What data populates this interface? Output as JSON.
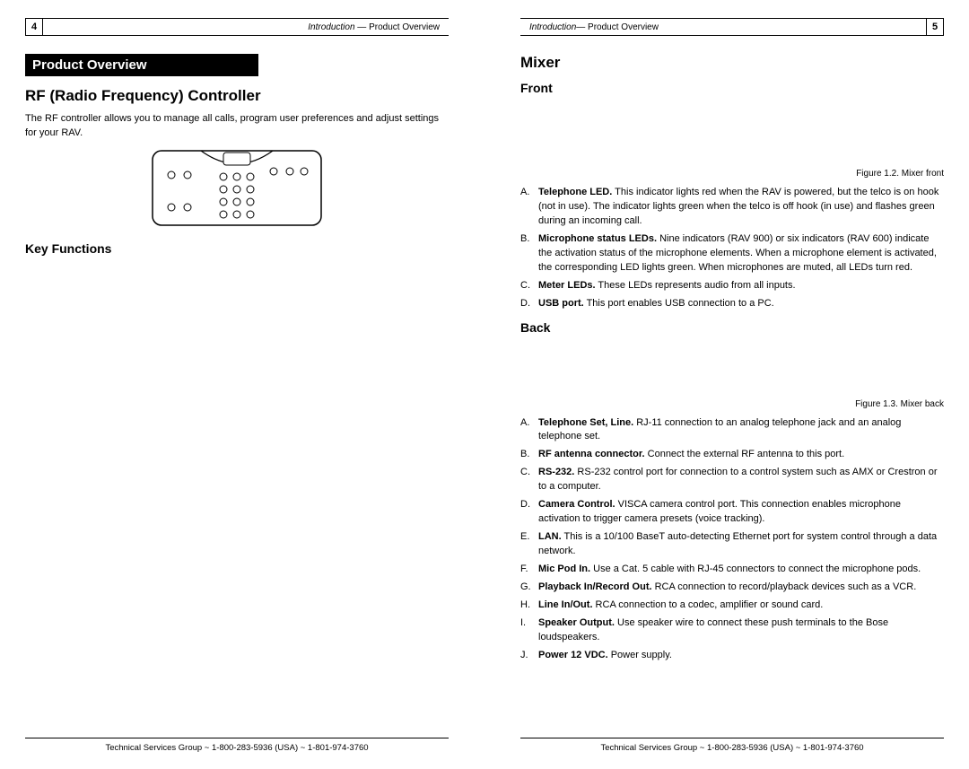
{
  "left": {
    "pageNum": "4",
    "header": {
      "italic": "Introduction",
      "rest": " — Product Overview"
    },
    "sectionBar": "Product Overview",
    "h1": "RF (Radio Frequency) Controller",
    "intro": "The RF controller allows you to manage all calls, program user preferences and adjust settings for your RAV.",
    "keyFunctions": "Key Functions",
    "footer": "Technical Services Group ~ 1-800-283-5936 (USA) ~ 1-801-974-3760"
  },
  "right": {
    "pageNum": "5",
    "header": {
      "italic": "Introduction",
      "rest": "— Product Overview"
    },
    "mixer": "Mixer",
    "front": "Front",
    "frontCaption": "Figure 1.2. Mixer front",
    "frontItems": [
      {
        "letter": "A.",
        "term": "Telephone LED.",
        "desc": " This indicator lights red when the RAV is powered, but the telco is on hook (not in use). The indicator lights green when the telco is off hook (in use) and flashes green during an incoming call."
      },
      {
        "letter": "B.",
        "term": "Microphone status LEDs.",
        "desc": " Nine indicators (RAV 900) or six indicators (RAV 600) indicate the activation status of the microphone elements. When a microphone element is activated, the corresponding LED lights green. When microphones are muted, all LEDs turn red."
      },
      {
        "letter": "C.",
        "term": "Meter LEDs.",
        "desc": " These LEDs represents audio from all inputs."
      },
      {
        "letter": "D.",
        "term": "USB port.",
        "desc": " This port enables USB connection to a PC."
      }
    ],
    "back": "Back",
    "backCaption": "Figure 1.3. Mixer back",
    "backItems": [
      {
        "letter": "A.",
        "term": "Telephone Set, Line.",
        "desc": " RJ-11 connection to an analog telephone jack and an analog telephone set."
      },
      {
        "letter": "B.",
        "term": "RF antenna connector.",
        "desc": " Connect the external RF antenna to this port."
      },
      {
        "letter": "C.",
        "term": "RS-232.",
        "desc": " RS-232 control port for connection to a control system such as AMX or Crestron or to a computer."
      },
      {
        "letter": "D.",
        "term": "Camera Control.",
        "desc": " VISCA camera control port. This connection enables microphone activation to trigger camera presets (voice tracking)."
      },
      {
        "letter": "E.",
        "term": "LAN.",
        "desc": " This is a 10/100 BaseT auto-detecting Ethernet port for system control through a data network."
      },
      {
        "letter": "F.",
        "term": "Mic Pod In.",
        "desc": " Use a Cat. 5 cable with RJ-45 connectors to connect the microphone pods."
      },
      {
        "letter": "G.",
        "term": "Playback In/Record Out.",
        "desc": " RCA connection to record/playback devices such as a VCR."
      },
      {
        "letter": "H.",
        "term": "Line In/Out.",
        "desc": " RCA connection to a codec, amplifier or sound card."
      },
      {
        "letter": "I.",
        "term": "Speaker Output.",
        "desc": " Use speaker wire to connect these push terminals to the Bose loudspeakers."
      },
      {
        "letter": "J.",
        "term": "Power 12 VDC.",
        "desc": " Power supply."
      }
    ],
    "footer": "Technical Services Group ~ 1-800-283-5936 (USA) ~ 1-801-974-3760"
  }
}
